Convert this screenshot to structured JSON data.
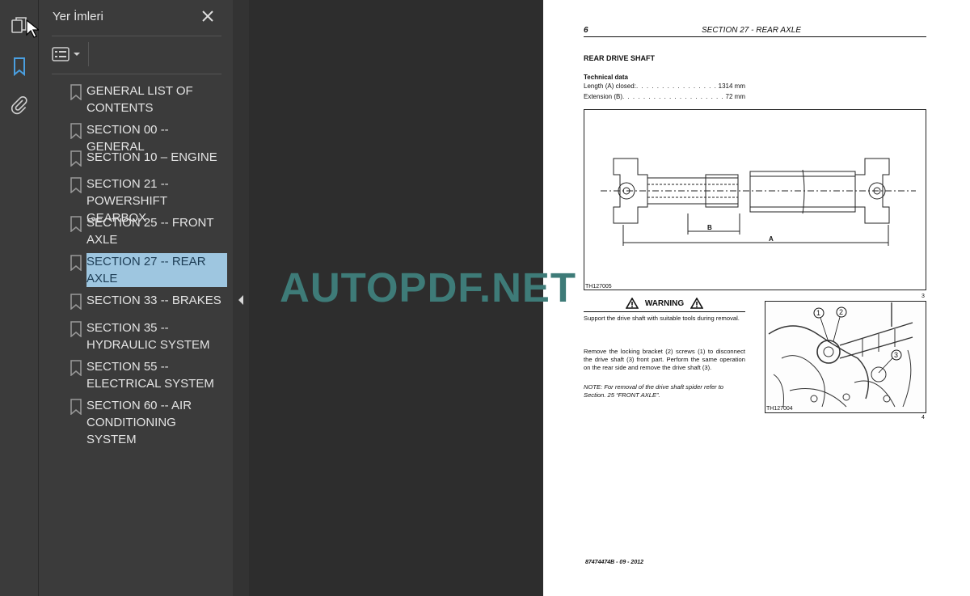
{
  "colors": {
    "accent": "#4a9fe0",
    "selection": "#9ec6e0",
    "watermark": "#3e7b78"
  },
  "rail": {
    "icons": [
      "pages-icon",
      "bookmark-icon",
      "attachment-icon"
    ]
  },
  "bookmarks_panel": {
    "title": "Yer İmleri",
    "items": [
      {
        "label": "GENERAL LIST OF CONTENTS",
        "selected": false
      },
      {
        "label": "SECTION 00 -- GENERAL",
        "selected": false
      },
      {
        "label": "SECTION 10 – ENGINE",
        "selected": false
      },
      {
        "label": "SECTION 21 -- POWERSHIFT GEARBOX",
        "selected": false
      },
      {
        "label": "SECTION 25 -- FRONT AXLE",
        "selected": false
      },
      {
        "label": "SECTION 27 -- REAR AXLE",
        "selected": true
      },
      {
        "label": "SECTION 33 -- BRAKES",
        "selected": false
      },
      {
        "label": "SECTION 35 -- HYDRAULIC SYSTEM",
        "selected": false
      },
      {
        "label": "SECTION 55 -- ELECTRICAL SYSTEM",
        "selected": false
      },
      {
        "label": "SECTION 60 -- AIR CONDITIONING SYSTEM",
        "selected": false
      }
    ]
  },
  "page": {
    "number": "6",
    "section": "SECTION 27 - REAR AXLE",
    "heading": "REAR DRIVE SHAFT",
    "tech_heading": "Technical data",
    "specs": [
      {
        "label": "Length (A) closed:",
        "value": "1314 mm"
      },
      {
        "label": "Extension (B)",
        "value": "72 mm"
      }
    ],
    "fig1": {
      "code": "TH127005",
      "num": "3",
      "label_a": "A",
      "label_b": "B"
    },
    "warning_title": "WARNING",
    "warning_text": "Support the drive shaft with suitable tools during removal.",
    "body": "Remove the locking bracket (2) screws (1) to disconnect the drive shaft (3) front part. Perform the same operation on the rear side and remove the drive shaft (3).",
    "note": "NOTE: For removal of the drive shaft spider refer to Section. 25 “FRONT AXLE”.",
    "fig2": {
      "code": "TH127004",
      "num": "4",
      "callouts": [
        "1",
        "2",
        "3"
      ]
    },
    "footer": "87474474B - 09 - 2012"
  },
  "watermark": "AUTOPDF.NET"
}
